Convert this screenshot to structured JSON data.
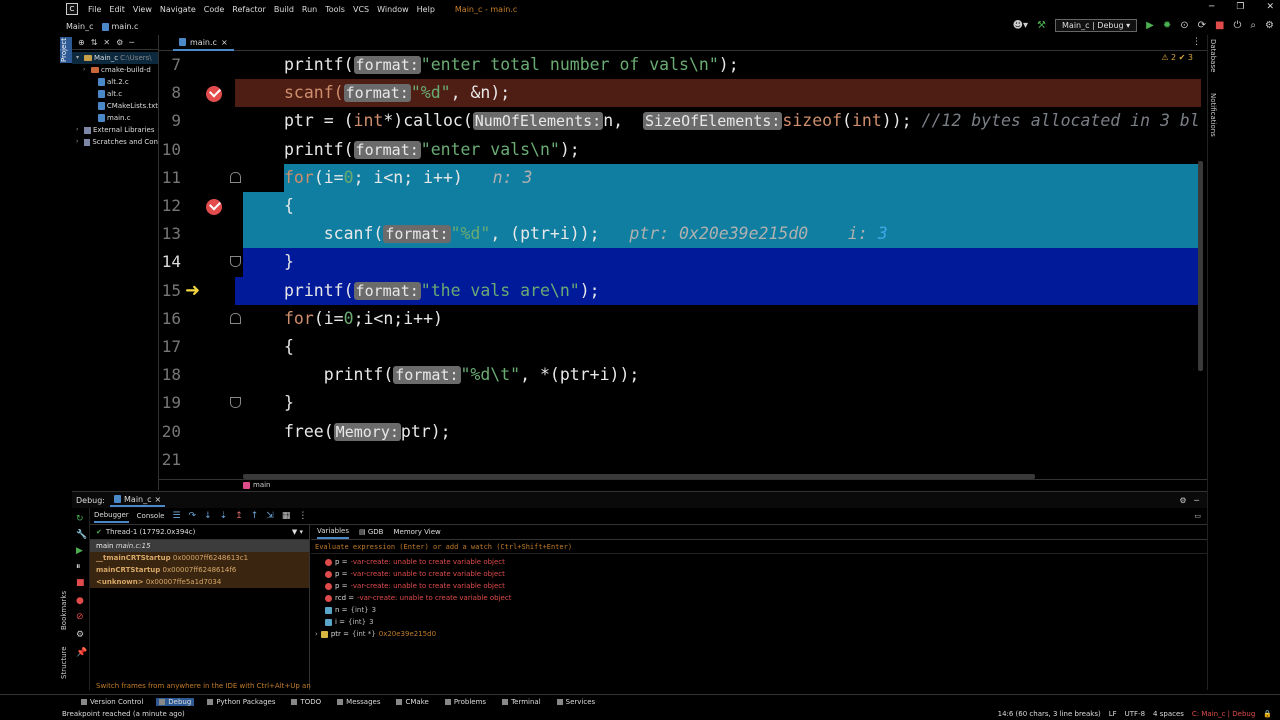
{
  "titlebar": {
    "menus": [
      "File",
      "Edit",
      "View",
      "Navigate",
      "Code",
      "Refactor",
      "Build",
      "Run",
      "Tools",
      "VCS",
      "Window",
      "Help"
    ],
    "title": "Main_c - main.c"
  },
  "navbar": {
    "project": "Main_c",
    "file": "main.c",
    "run_config": "Main_c | Debug"
  },
  "project_panel": {
    "items": [
      {
        "label": "Main_c",
        "extra": "C:\\Users\\",
        "type": "folder",
        "arrow": "▾"
      },
      {
        "label": "cmake-build-d",
        "type": "folder-orange",
        "arrow": "›"
      },
      {
        "label": "alt.2.c",
        "type": "file",
        "arrow": ""
      },
      {
        "label": "alt.c",
        "type": "file",
        "arrow": ""
      },
      {
        "label": "CMakeLists.txt",
        "type": "file",
        "arrow": ""
      },
      {
        "label": "main.c",
        "type": "file",
        "arrow": ""
      },
      {
        "label": "External Libraries",
        "type": "lib",
        "arrow": "›"
      },
      {
        "label": "Scratches and Con",
        "type": "lib",
        "arrow": "›"
      }
    ]
  },
  "editor": {
    "tab": "main.c",
    "inspection": "⚠ 2  ✔ 3",
    "lines": [
      {
        "n": "7",
        "html_parts": [
          [
            "fn",
            "printf("
          ],
          [
            "hint",
            "format:"
          ],
          [
            "str",
            "\"enter total number of vals\\n\""
          ],
          [
            "fn",
            ");"
          ]
        ]
      },
      {
        "n": "8",
        "html_parts": [
          [
            "kw",
            "scanf("
          ],
          [
            "hint",
            "format:"
          ],
          [
            "str",
            "\"%d\""
          ],
          [
            "fn",
            ", &n);"
          ]
        ]
      },
      {
        "n": "9",
        "html_parts": [
          [
            "fn",
            "ptr = ("
          ],
          [
            "kw",
            "int"
          ],
          [
            "fn",
            "*)calloc("
          ],
          [
            "hint",
            "NumOfElements:"
          ],
          [
            "fn",
            "n,  "
          ],
          [
            "hint",
            "SizeOfElements:"
          ],
          [
            "kw",
            "sizeof"
          ],
          [
            "fn",
            "("
          ],
          [
            "kw",
            "int"
          ],
          [
            "fn",
            "));"
          ],
          [
            "cmt",
            " //12 bytes allocated in 3 bl"
          ]
        ]
      },
      {
        "n": "10",
        "html_parts": [
          [
            "fn",
            "printf("
          ],
          [
            "hint",
            "format:"
          ],
          [
            "str",
            "\"enter vals\\n\""
          ],
          [
            "fn",
            ");"
          ]
        ]
      },
      {
        "n": "11",
        "html_parts": [
          [
            "kw",
            "for"
          ],
          [
            "fn",
            "(i="
          ],
          [
            "str",
            "0"
          ],
          [
            "fn",
            "; i<n; i++)   "
          ],
          [
            "inl",
            "n: 3"
          ]
        ]
      },
      {
        "n": "12",
        "html_parts": [
          [
            "fn",
            "{"
          ]
        ]
      },
      {
        "n": "13",
        "html_parts": [
          [
            "fn",
            "    scanf("
          ],
          [
            "hint",
            "format:"
          ],
          [
            "str",
            "\"%d\""
          ],
          [
            "fn",
            ", (ptr+i));   "
          ],
          [
            "inl",
            "ptr: 0x20e39e215d0    i: "
          ],
          [
            "inlnum",
            "3"
          ]
        ]
      },
      {
        "n": "14",
        "html_parts": [
          [
            "fn",
            "}"
          ]
        ]
      },
      {
        "n": "15",
        "html_parts": [
          [
            "fn",
            "printf("
          ],
          [
            "hint",
            "format:"
          ],
          [
            "str",
            "\"the vals are\\n\""
          ],
          [
            "fn",
            ");"
          ]
        ]
      },
      {
        "n": "16",
        "html_parts": [
          [
            "kw",
            "for"
          ],
          [
            "fn",
            "(i="
          ],
          [
            "str",
            "0"
          ],
          [
            "fn",
            ";i<n;i++)"
          ]
        ]
      },
      {
        "n": "17",
        "html_parts": [
          [
            "fn",
            "{"
          ]
        ]
      },
      {
        "n": "18",
        "html_parts": [
          [
            "fn",
            "    printf("
          ],
          [
            "hint",
            "format:"
          ],
          [
            "str",
            "\"%d\\t\""
          ],
          [
            "fn",
            ", *(ptr+i));"
          ]
        ]
      },
      {
        "n": "19",
        "html_parts": [
          [
            "fn",
            "}"
          ]
        ]
      },
      {
        "n": "20",
        "html_parts": [
          [
            "fn",
            "free("
          ],
          [
            "hint",
            "Memory:"
          ],
          [
            "fn",
            "ptr);"
          ]
        ]
      },
      {
        "n": "21",
        "html_parts": []
      }
    ],
    "breadcrumb": "main"
  },
  "debug": {
    "label": "Debug:",
    "session": "Main_c",
    "tabs": [
      "Debugger",
      "Console"
    ],
    "thread": "Thread-1 (17792.0x394c)",
    "frames": [
      {
        "fn": "main",
        "loc": "main.c:15"
      },
      {
        "fn": "__tmainCRTStartup",
        "loc": "0x00007ff6248613c1"
      },
      {
        "fn": "mainCRTStartup",
        "loc": "0x00007ff6248614f6"
      },
      {
        "fn": "<unknown>",
        "loc": "0x00007ffe5a1d7034"
      }
    ],
    "tip": "Switch frames from anywhere in the IDE with Ctrl+Alt+Up and ...",
    "var_tabs": [
      "Variables",
      "GDB",
      "Memory View"
    ],
    "eval_placeholder": "Evaluate expression (Enter) or add a watch (Ctrl+Shift+Enter)",
    "variables": [
      {
        "kind": "err",
        "name": "p",
        "value": "-var-create: unable to create variable object"
      },
      {
        "kind": "err",
        "name": "p",
        "value": "-var-create: unable to create variable object"
      },
      {
        "kind": "err",
        "name": "p",
        "value": "-var-create: unable to create variable object"
      },
      {
        "kind": "err",
        "name": "rcd",
        "value": "-var-create: unable to create variable object"
      },
      {
        "kind": "int",
        "name": "n",
        "type": "{int}",
        "value": "3"
      },
      {
        "kind": "int",
        "name": "i",
        "type": "{int}",
        "value": "3"
      },
      {
        "kind": "ptr",
        "name": "ptr",
        "type": "{int *}",
        "value": "0x20e39e215d0"
      }
    ]
  },
  "bottom_tools": [
    "Version Control",
    "Debug",
    "Python Packages",
    "TODO",
    "Messages",
    "CMake",
    "Problems",
    "Terminal",
    "Services"
  ],
  "status": {
    "message": "Breakpoint reached (a minute ago)",
    "position": "14:6 (60 chars, 3 line breaks)",
    "eol": "LF",
    "encoding": "UTF-8",
    "indent": "4 spaces",
    "config": "C: Main_c | Debug"
  },
  "side_tabs": {
    "left": [
      "Project",
      "Bookmarks",
      "Structure"
    ],
    "right": [
      "Database",
      "Notifications"
    ]
  }
}
